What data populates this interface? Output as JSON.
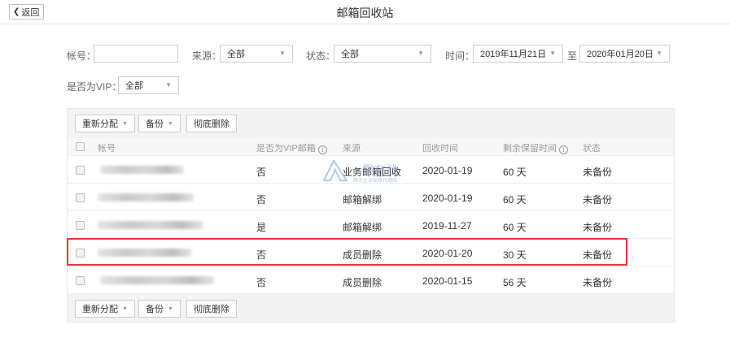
{
  "header": {
    "back_label": "返回",
    "title": "邮箱回收站"
  },
  "filters": {
    "account_label": "帐号：",
    "account_value": "",
    "source_label": "来源：",
    "source_value": "全部",
    "status_label": "状态：",
    "status_value": "全部",
    "time_label": "时间：",
    "time_start": "2019年11月21日",
    "time_sep": "至",
    "time_end": "2020年01月20日",
    "vip_label": "是否为VIP：",
    "vip_value": "全部"
  },
  "toolbar": {
    "reassign": "重新分配",
    "backup": "备份",
    "delete": "彻底删除"
  },
  "columns": {
    "account": "帐号",
    "vip": "是否为VIP邮箱",
    "source": "来源",
    "recycle_time": "回收时间",
    "remaining": "剩余保留时间",
    "status": "状态"
  },
  "rows": [
    {
      "vip": "否",
      "source": "业务邮箱回收",
      "recycle_time": "2020-01-19",
      "remaining": "60 天",
      "status": "未备份"
    },
    {
      "vip": "否",
      "source": "邮箱解绑",
      "recycle_time": "2020-01-19",
      "remaining": "60 天",
      "status": "未备份"
    },
    {
      "vip": "是",
      "source": "邮箱解绑",
      "recycle_time": "2019-11-27",
      "remaining": "60 天",
      "status": "未备份"
    },
    {
      "vip": "否",
      "source": "成员删除",
      "recycle_time": "2020-01-20",
      "remaining": "30 天",
      "status": "未备份"
    },
    {
      "vip": "否",
      "source": "成员删除",
      "recycle_time": "2020-01-15",
      "remaining": "56 天",
      "status": "未备份"
    }
  ],
  "watermark": {
    "title": "一零在线",
    "sub": "腾讯企业邮箱代理商"
  },
  "icons": {
    "back": "chevron-left-icon",
    "dropdown": "caret-down-icon",
    "info": "info-circle-icon"
  },
  "colors": {
    "highlight": "#e53935",
    "toolbar_bg": "#f3f3f3"
  }
}
